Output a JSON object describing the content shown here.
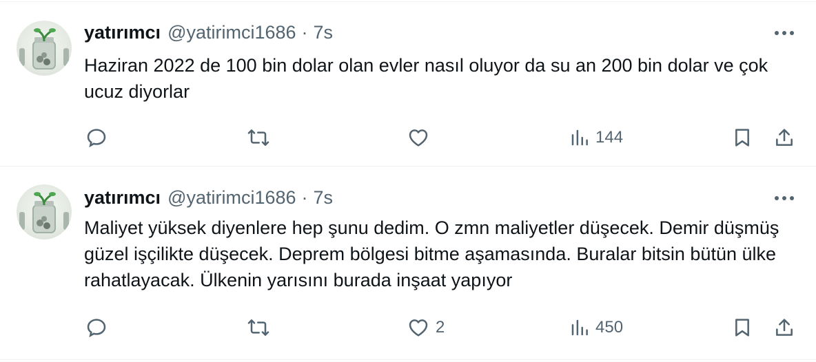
{
  "tweets": [
    {
      "name": "yatırımcı",
      "handle": "@yatirimci1686",
      "separator": "·",
      "time": "7s",
      "text": "Haziran 2022 de 100 bin dolar olan evler nasıl oluyor da su an 200 bin dolar ve çok ucuz diyorlar",
      "replies": "",
      "retweets": "",
      "likes": "",
      "views": "144"
    },
    {
      "name": "yatırımcı",
      "handle": "@yatirimci1686",
      "separator": "·",
      "time": "7s",
      "text": "Maliyet yüksek diyenlere hep şunu dedim. O zmn maliyetler düşecek. Demir düşmüş güzel işçilikte düşecek. Deprem bölgesi bitme aşamasında. Buralar bitsin bütün ülke rahatlayacak. Ülkenin yarısını burada inşaat yapıyor",
      "replies": "",
      "retweets": "",
      "likes": "2",
      "views": "450"
    }
  ],
  "colors": {
    "text": "#0f1419",
    "secondary": "#536471",
    "divider": "#eff3f4"
  },
  "icons": [
    "avatar-jar-icon",
    "more-icon",
    "reply-icon",
    "retweet-icon",
    "like-icon",
    "views-icon",
    "bookmark-icon",
    "share-icon"
  ]
}
